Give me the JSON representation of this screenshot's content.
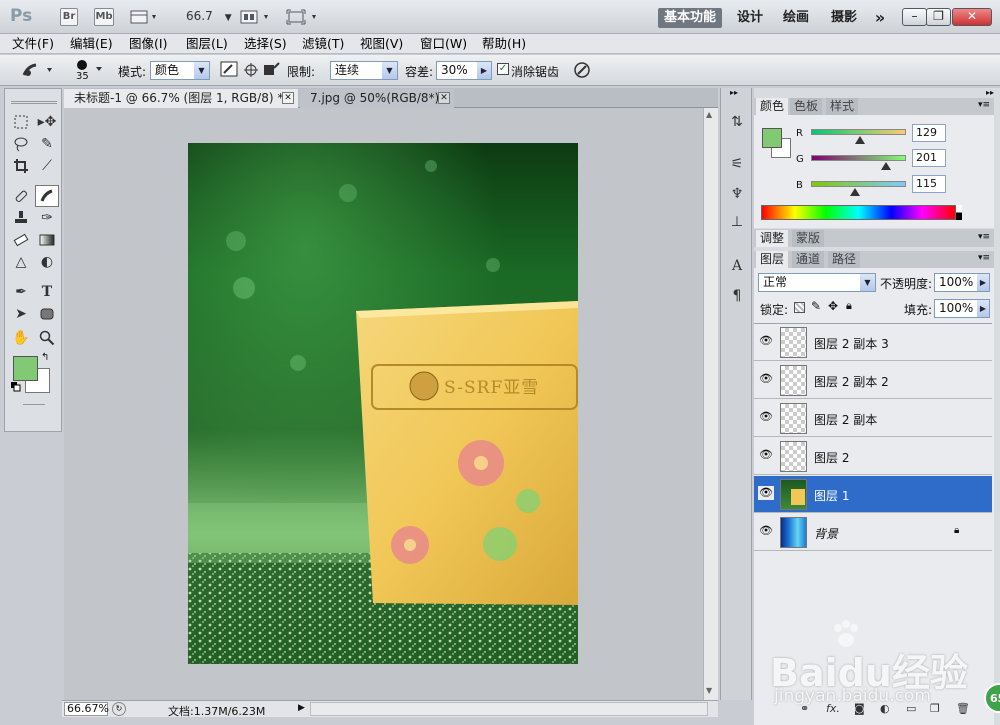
{
  "titlebar": {
    "app_logo": "Ps",
    "bridge": "Br",
    "minibridge": "Mb",
    "zoom": "66.7",
    "workspaces": [
      "基本功能",
      "设计",
      "绘画",
      "摄影"
    ],
    "more": "»"
  },
  "menus": [
    "文件(F)",
    "编辑(E)",
    "图像(I)",
    "图层(L)",
    "选择(S)",
    "滤镜(T)",
    "视图(V)",
    "窗口(W)",
    "帮助(H)"
  ],
  "options": {
    "brush_size": "35",
    "mode_label": "模式:",
    "mode_value": "颜色",
    "limit_label": "限制:",
    "limit_value": "连续",
    "tolerance_label": "容差:",
    "tolerance_value": "30%",
    "antialias_label": "消除锯齿",
    "antialias_checked": true
  },
  "document_tabs": [
    {
      "label": "未标题-1 @ 66.7% (图层 1, RGB/8) *",
      "active": true
    },
    {
      "label": "7.jpg @ 50%(RGB/8*)",
      "active": false
    }
  ],
  "status": {
    "zoom": "66.67%",
    "doc_info": "文档:1.37M/6.23M"
  },
  "color_panel": {
    "tabs": [
      "颜色",
      "色板",
      "样式"
    ],
    "r_label": "R",
    "g_label": "G",
    "b_label": "B",
    "r": "129",
    "g": "201",
    "b": "115",
    "fg_color": "#81c973",
    "bg_color": "#ffffff"
  },
  "adjust_panel": {
    "tabs": [
      "调整",
      "蒙版"
    ]
  },
  "layers_panel": {
    "tabs": [
      "图层",
      "通道",
      "路径"
    ],
    "blend_mode": "正常",
    "opacity_label": "不透明度:",
    "opacity": "100%",
    "lock_label": "锁定:",
    "fill_label": "填充:",
    "fill": "100%",
    "layers": [
      {
        "name": "图层 2 副本 3",
        "selected": false,
        "thumb": "transparent"
      },
      {
        "name": "图层 2 副本 2",
        "selected": false,
        "thumb": "transparent"
      },
      {
        "name": "图层 2 副本",
        "selected": false,
        "thumb": "transparent"
      },
      {
        "name": "图层 2",
        "selected": false,
        "thumb": "transparent"
      },
      {
        "name": "图层 1",
        "selected": true,
        "thumb": "photo"
      },
      {
        "name": "背景",
        "selected": false,
        "thumb": "gradient",
        "locked": true
      }
    ]
  },
  "canvas": {
    "box_logo_text": "S-SRF亚雪"
  },
  "watermark": {
    "brand": "Baidu经验",
    "url": "jingyan.baidu.com",
    "badge": "65"
  },
  "colors": {
    "accent_selected": "#2f6bc8",
    "fg_swatch": "#81c973"
  }
}
